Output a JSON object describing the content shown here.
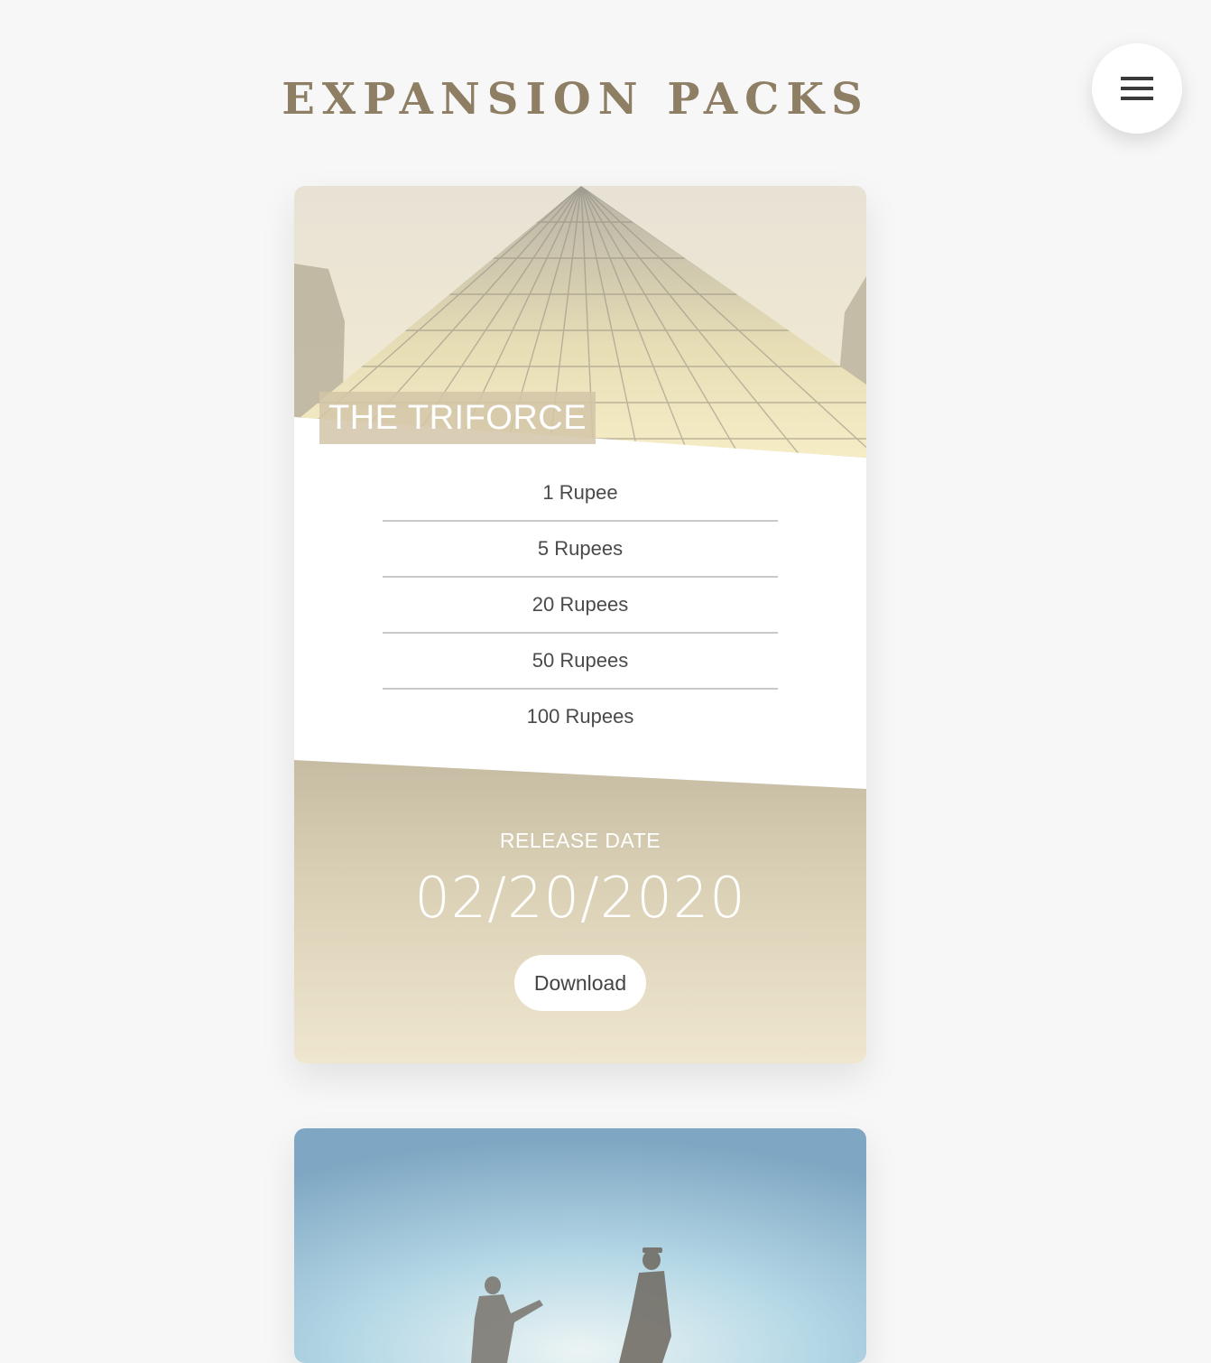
{
  "header": {
    "title": "EXPANSION PACKS",
    "menu_icon": "hamburger-menu-icon"
  },
  "cards": [
    {
      "name": "THE TRIFORCE",
      "image": "glass-pyramid-photo",
      "prices": [
        "1 Rupee",
        "5 Rupees",
        "20 Rupees",
        "50 Rupees",
        "100 Rupees"
      ],
      "release_label": "RELEASE DATE",
      "release_date": "02/20/2020",
      "download_label": "Download"
    },
    {
      "image": "sky-silhouettes-photo"
    }
  ],
  "colors": {
    "page_background": "#f7f7f7",
    "title": "#8e7e64",
    "accent_top": "#c6bca3",
    "accent_bottom": "#efe6d0",
    "card": "#ffffff"
  }
}
